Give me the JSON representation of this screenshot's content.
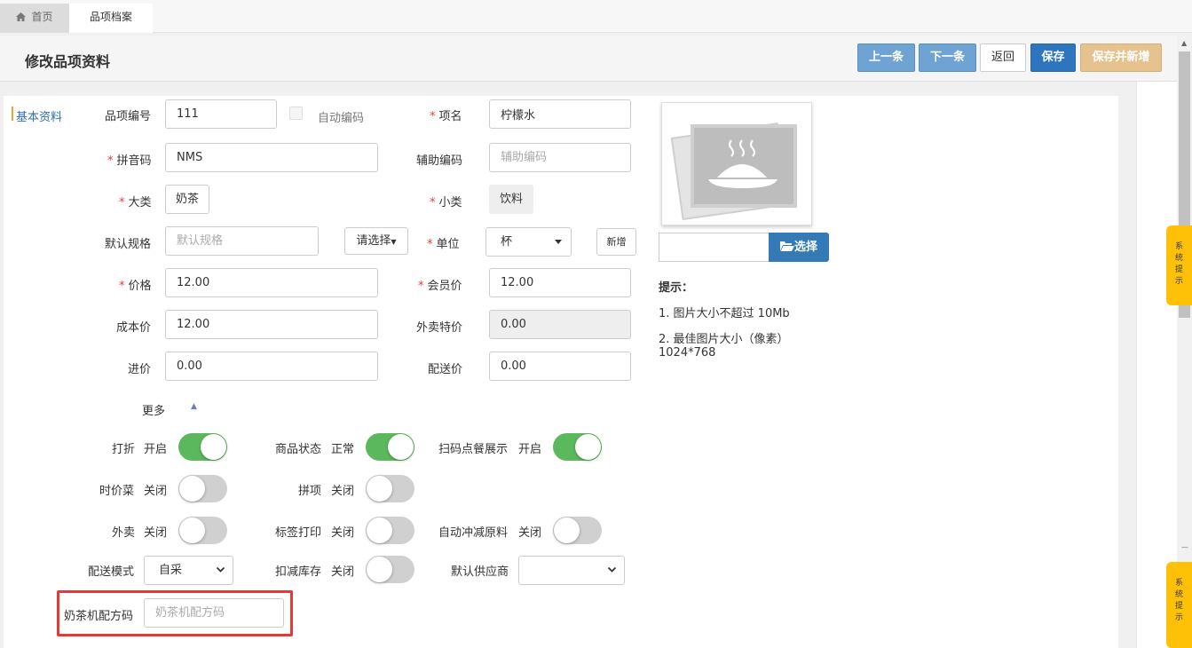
{
  "tabs": {
    "home": "首页",
    "active": "品项档案"
  },
  "header": {
    "title": "修改品项资料",
    "prev": "上一条",
    "next": "下一条",
    "back": "返回",
    "save": "保存",
    "save_new": "保存并新增"
  },
  "section": "基本资料",
  "fields": {
    "code_label": "品项编号",
    "code_value": "111",
    "auto_code_label": "自动编码",
    "name_label": "项名",
    "name_value": "柠檬水",
    "pinyin_label": "拼音码",
    "pinyin_value": "NMS",
    "aux_label": "辅助编码",
    "aux_placeholder": "辅助编码",
    "category_label": "大类",
    "category_value": "奶茶",
    "subcategory_label": "小类",
    "subcategory_value": "饮料",
    "spec_label": "默认规格",
    "spec_placeholder": "默认规格",
    "spec_choose": "请选择",
    "unit_label": "单位",
    "unit_value": "杯",
    "unit_add": "新增",
    "price_label": "价格",
    "price_value": "12.00",
    "member_label": "会员价",
    "member_value": "12.00",
    "cost_label": "成本价",
    "cost_value": "12.00",
    "takeout_price_label": "外卖特价",
    "takeout_price_value": "0.00",
    "purchase_label": "进价",
    "purchase_value": "0.00",
    "delivery_price_label": "配送价",
    "delivery_price_value": "0.00",
    "more_label": "更多"
  },
  "switches": {
    "discount": {
      "label": "打折",
      "state": "开启",
      "on": true
    },
    "status": {
      "label": "商品状态",
      "state": "正常",
      "on": true
    },
    "scan_show": {
      "label": "扫码点餐展示",
      "state": "开启",
      "on": true
    },
    "seasonal": {
      "label": "时价菜",
      "state": "关闭",
      "on": false
    },
    "combo": {
      "label": "拼项",
      "state": "关闭",
      "on": false
    },
    "takeout": {
      "label": "外卖",
      "state": "关闭",
      "on": false
    },
    "label_print": {
      "label": "标签打印",
      "state": "关闭",
      "on": false
    },
    "auto_deduct": {
      "label": "自动冲减原料",
      "state": "关闭",
      "on": false
    },
    "deduct_stock": {
      "label": "扣减库存",
      "state": "关闭",
      "on": false
    }
  },
  "delivery": {
    "label": "配送模式",
    "value": "自采"
  },
  "supplier": {
    "label": "默认供应商",
    "value": ""
  },
  "milk_tea": {
    "label": "奶茶机配方码",
    "placeholder": "奶茶机配方码"
  },
  "photo": {
    "choose": "选择",
    "hint_title": "提示：",
    "hint1": "1. 图片大小不超过 10Mb",
    "hint2": "2. 最佳图片大小（像素）",
    "hint3": "1024*768"
  },
  "system_tip": "系统提示",
  "colors": {
    "accent": "#2e75c0",
    "toggle_on": "#5cb85c",
    "highlight": "#e53935",
    "tip": "#ffc107"
  }
}
